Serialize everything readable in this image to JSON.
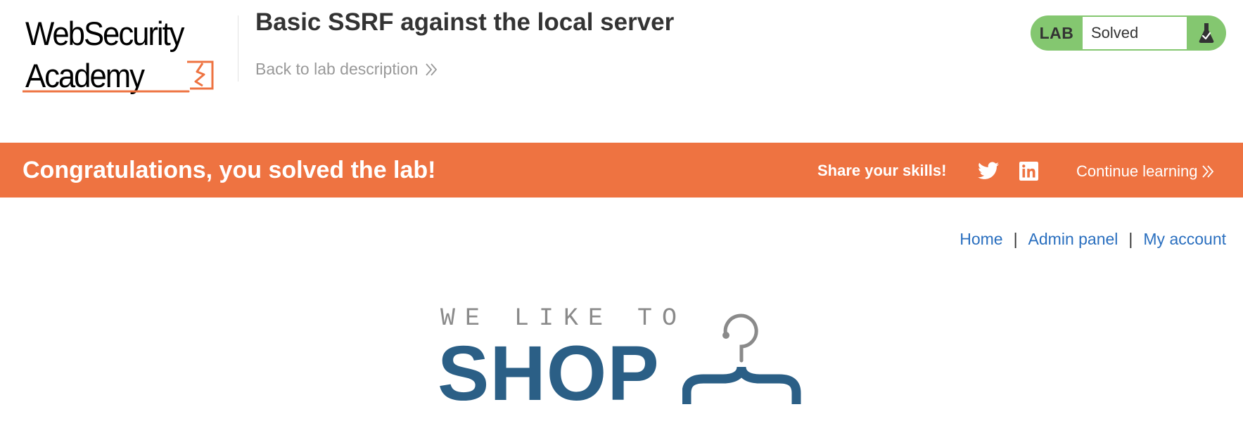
{
  "header": {
    "logo": {
      "line1": "WebSecurity",
      "line2": "Academy"
    },
    "lab_title": "Basic SSRF against the local server",
    "back_link": "Back to lab description",
    "lab_status": {
      "tag": "LAB",
      "state": "Solved",
      "icon": "flask-icon"
    }
  },
  "banner": {
    "message": "Congratulations, you solved the lab!",
    "share_label": "Share your skills!",
    "share_icons": [
      "twitter-icon",
      "linkedin-icon"
    ],
    "continue_label": "Continue learning"
  },
  "nav": {
    "items": [
      {
        "label": "Home"
      },
      {
        "label": "Admin panel"
      },
      {
        "label": "My account"
      }
    ],
    "separator": "|"
  },
  "shop_logo": {
    "tagline": "WE LIKE TO",
    "word": "SHOP",
    "icon": "hanger-icon"
  },
  "colors": {
    "brand_orange": "#ee7341",
    "lab_solved_green": "#84c770",
    "link_blue": "#2a6fbf",
    "shop_blue": "#2b5f86"
  }
}
